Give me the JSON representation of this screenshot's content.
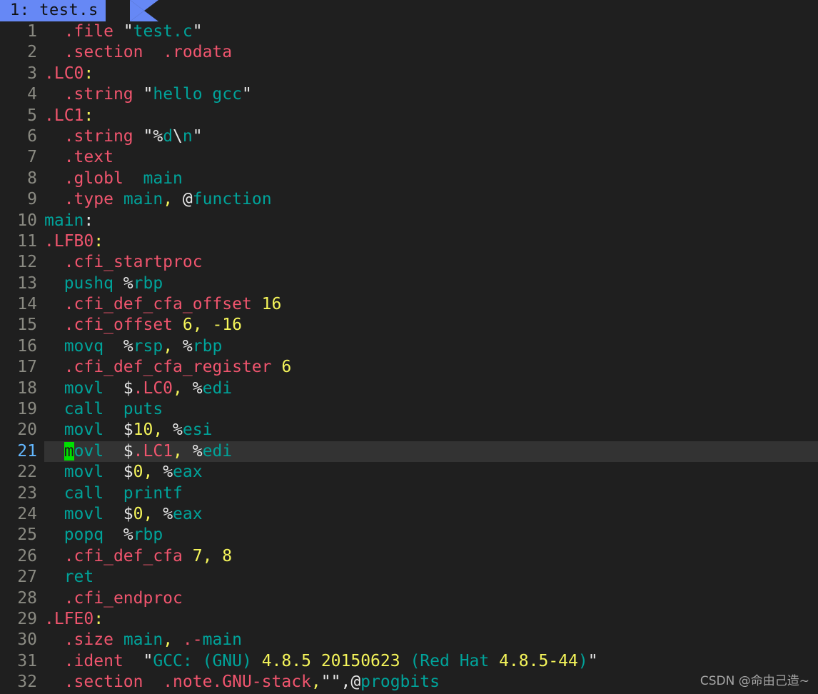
{
  "editor": {
    "tab": {
      "label": "1: test.s",
      "index": "1",
      "filename": "test.s",
      "active_bg": "#6688f5",
      "active_fg": "#101010"
    },
    "background": "#1f1f1f",
    "gutter_color": "#8a8a82",
    "current_line_number": 21,
    "current_line_bg": "#333333",
    "current_line_number_color": "#63b8ff",
    "cursor": {
      "line": 21,
      "column": 3,
      "char": "m",
      "bg": "#00e000",
      "fg": "#1b1b1b"
    },
    "palette": {
      "directive": "#f0556e",
      "identifier": "#00a39a",
      "number": "#f5f55a",
      "plain": "#e6e6e6"
    }
  },
  "watermark": {
    "text": "CSDN @命由己造~"
  },
  "lines": [
    {
      "n": "1",
      "tokens": [
        {
          "t": "plain",
          "v": "  "
        },
        {
          "t": "dir",
          "v": ".file"
        },
        {
          "t": "plain",
          "v": " "
        },
        {
          "t": "plain",
          "v": "\""
        },
        {
          "t": "id",
          "v": "test.c"
        },
        {
          "t": "plain",
          "v": "\""
        }
      ]
    },
    {
      "n": "2",
      "tokens": [
        {
          "t": "plain",
          "v": "  "
        },
        {
          "t": "dir",
          "v": ".section"
        },
        {
          "t": "plain",
          "v": "  "
        },
        {
          "t": "dir",
          "v": ".rodata"
        }
      ]
    },
    {
      "n": "3",
      "tokens": [
        {
          "t": "dir",
          "v": ".LC0"
        },
        {
          "t": "num",
          "v": ":"
        }
      ]
    },
    {
      "n": "4",
      "tokens": [
        {
          "t": "plain",
          "v": "  "
        },
        {
          "t": "dir",
          "v": ".string"
        },
        {
          "t": "plain",
          "v": " \""
        },
        {
          "t": "id",
          "v": "hello gcc"
        },
        {
          "t": "plain",
          "v": "\""
        }
      ]
    },
    {
      "n": "5",
      "tokens": [
        {
          "t": "dir",
          "v": ".LC1"
        },
        {
          "t": "num",
          "v": ":"
        }
      ]
    },
    {
      "n": "6",
      "tokens": [
        {
          "t": "plain",
          "v": "  "
        },
        {
          "t": "dir",
          "v": ".string"
        },
        {
          "t": "plain",
          "v": " \"%"
        },
        {
          "t": "id",
          "v": "d"
        },
        {
          "t": "plain",
          "v": "\\"
        },
        {
          "t": "id",
          "v": "n"
        },
        {
          "t": "plain",
          "v": "\""
        }
      ]
    },
    {
      "n": "7",
      "tokens": [
        {
          "t": "plain",
          "v": "  "
        },
        {
          "t": "dir",
          "v": ".text"
        }
      ]
    },
    {
      "n": "8",
      "tokens": [
        {
          "t": "plain",
          "v": "  "
        },
        {
          "t": "dir",
          "v": ".globl"
        },
        {
          "t": "plain",
          "v": "  "
        },
        {
          "t": "id",
          "v": "main"
        }
      ]
    },
    {
      "n": "9",
      "tokens": [
        {
          "t": "plain",
          "v": "  "
        },
        {
          "t": "dir",
          "v": ".type"
        },
        {
          "t": "plain",
          "v": " "
        },
        {
          "t": "id",
          "v": "main"
        },
        {
          "t": "num",
          "v": ","
        },
        {
          "t": "plain",
          "v": " @"
        },
        {
          "t": "id",
          "v": "function"
        }
      ]
    },
    {
      "n": "10",
      "tokens": [
        {
          "t": "id",
          "v": "main"
        },
        {
          "t": "plain",
          "v": ":"
        }
      ]
    },
    {
      "n": "11",
      "tokens": [
        {
          "t": "dir",
          "v": ".LFB0"
        },
        {
          "t": "num",
          "v": ":"
        }
      ]
    },
    {
      "n": "12",
      "tokens": [
        {
          "t": "plain",
          "v": "  "
        },
        {
          "t": "dir",
          "v": ".cfi_startproc"
        }
      ]
    },
    {
      "n": "13",
      "tokens": [
        {
          "t": "plain",
          "v": "  "
        },
        {
          "t": "id",
          "v": "pushq"
        },
        {
          "t": "plain",
          "v": " %"
        },
        {
          "t": "id",
          "v": "rbp"
        }
      ]
    },
    {
      "n": "14",
      "tokens": [
        {
          "t": "plain",
          "v": "  "
        },
        {
          "t": "dir",
          "v": ".cfi_def_cfa_offset"
        },
        {
          "t": "plain",
          "v": " "
        },
        {
          "t": "num",
          "v": "16"
        }
      ]
    },
    {
      "n": "15",
      "tokens": [
        {
          "t": "plain",
          "v": "  "
        },
        {
          "t": "dir",
          "v": ".cfi_offset"
        },
        {
          "t": "plain",
          "v": " "
        },
        {
          "t": "num",
          "v": "6,"
        },
        {
          "t": "plain",
          "v": " "
        },
        {
          "t": "num",
          "v": "-16"
        }
      ]
    },
    {
      "n": "16",
      "tokens": [
        {
          "t": "plain",
          "v": "  "
        },
        {
          "t": "id",
          "v": "movq"
        },
        {
          "t": "plain",
          "v": "  %"
        },
        {
          "t": "id",
          "v": "rsp"
        },
        {
          "t": "num",
          "v": ","
        },
        {
          "t": "plain",
          "v": " %"
        },
        {
          "t": "id",
          "v": "rbp"
        }
      ]
    },
    {
      "n": "17",
      "tokens": [
        {
          "t": "plain",
          "v": "  "
        },
        {
          "t": "dir",
          "v": ".cfi_def_cfa_register"
        },
        {
          "t": "plain",
          "v": " "
        },
        {
          "t": "num",
          "v": "6"
        }
      ]
    },
    {
      "n": "18",
      "tokens": [
        {
          "t": "plain",
          "v": "  "
        },
        {
          "t": "id",
          "v": "movl"
        },
        {
          "t": "plain",
          "v": "  $"
        },
        {
          "t": "dir",
          "v": ".LC0"
        },
        {
          "t": "num",
          "v": ","
        },
        {
          "t": "plain",
          "v": " %"
        },
        {
          "t": "id",
          "v": "edi"
        }
      ]
    },
    {
      "n": "19",
      "tokens": [
        {
          "t": "plain",
          "v": "  "
        },
        {
          "t": "id",
          "v": "call"
        },
        {
          "t": "plain",
          "v": "  "
        },
        {
          "t": "id",
          "v": "puts"
        }
      ]
    },
    {
      "n": "20",
      "tokens": [
        {
          "t": "plain",
          "v": "  "
        },
        {
          "t": "id",
          "v": "movl"
        },
        {
          "t": "plain",
          "v": "  $"
        },
        {
          "t": "num",
          "v": "10,"
        },
        {
          "t": "plain",
          "v": " %"
        },
        {
          "t": "id",
          "v": "esi"
        }
      ]
    },
    {
      "n": "21",
      "tokens": [
        {
          "t": "plain",
          "v": "  "
        },
        {
          "t": "cursor",
          "v": "m"
        },
        {
          "t": "id",
          "v": "ovl"
        },
        {
          "t": "plain",
          "v": "  $"
        },
        {
          "t": "dir",
          "v": ".LC1"
        },
        {
          "t": "num",
          "v": ","
        },
        {
          "t": "plain",
          "v": " %"
        },
        {
          "t": "id",
          "v": "edi"
        }
      ]
    },
    {
      "n": "22",
      "tokens": [
        {
          "t": "plain",
          "v": "  "
        },
        {
          "t": "id",
          "v": "movl"
        },
        {
          "t": "plain",
          "v": "  $"
        },
        {
          "t": "num",
          "v": "0,"
        },
        {
          "t": "plain",
          "v": " %"
        },
        {
          "t": "id",
          "v": "eax"
        }
      ]
    },
    {
      "n": "23",
      "tokens": [
        {
          "t": "plain",
          "v": "  "
        },
        {
          "t": "id",
          "v": "call"
        },
        {
          "t": "plain",
          "v": "  "
        },
        {
          "t": "id",
          "v": "printf"
        }
      ]
    },
    {
      "n": "24",
      "tokens": [
        {
          "t": "plain",
          "v": "  "
        },
        {
          "t": "id",
          "v": "movl"
        },
        {
          "t": "plain",
          "v": "  $"
        },
        {
          "t": "num",
          "v": "0,"
        },
        {
          "t": "plain",
          "v": " %"
        },
        {
          "t": "id",
          "v": "eax"
        }
      ]
    },
    {
      "n": "25",
      "tokens": [
        {
          "t": "plain",
          "v": "  "
        },
        {
          "t": "id",
          "v": "popq"
        },
        {
          "t": "plain",
          "v": "  %"
        },
        {
          "t": "id",
          "v": "rbp"
        }
      ]
    },
    {
      "n": "26",
      "tokens": [
        {
          "t": "plain",
          "v": "  "
        },
        {
          "t": "dir",
          "v": ".cfi_def_cfa"
        },
        {
          "t": "plain",
          "v": " "
        },
        {
          "t": "num",
          "v": "7,"
        },
        {
          "t": "plain",
          "v": " "
        },
        {
          "t": "num",
          "v": "8"
        }
      ]
    },
    {
      "n": "27",
      "tokens": [
        {
          "t": "plain",
          "v": "  "
        },
        {
          "t": "id",
          "v": "ret"
        }
      ]
    },
    {
      "n": "28",
      "tokens": [
        {
          "t": "plain",
          "v": "  "
        },
        {
          "t": "dir",
          "v": ".cfi_endproc"
        }
      ]
    },
    {
      "n": "29",
      "tokens": [
        {
          "t": "dir",
          "v": ".LFE0"
        },
        {
          "t": "num",
          "v": ":"
        }
      ]
    },
    {
      "n": "30",
      "tokens": [
        {
          "t": "plain",
          "v": "  "
        },
        {
          "t": "dir",
          "v": ".size"
        },
        {
          "t": "plain",
          "v": " "
        },
        {
          "t": "id",
          "v": "main"
        },
        {
          "t": "num",
          "v": ","
        },
        {
          "t": "plain",
          "v": " "
        },
        {
          "t": "dir",
          "v": ".-"
        },
        {
          "t": "id",
          "v": "main"
        }
      ]
    },
    {
      "n": "31",
      "tokens": [
        {
          "t": "plain",
          "v": "  "
        },
        {
          "t": "dir",
          "v": ".ident"
        },
        {
          "t": "plain",
          "v": "  \""
        },
        {
          "t": "id",
          "v": "GCC: "
        },
        {
          "t": "id",
          "v": "(GNU)"
        },
        {
          "t": "plain",
          "v": " "
        },
        {
          "t": "num",
          "v": "4.8.5"
        },
        {
          "t": "plain",
          "v": " "
        },
        {
          "t": "num",
          "v": "20150623"
        },
        {
          "t": "plain",
          "v": " "
        },
        {
          "t": "id",
          "v": "(Red Hat "
        },
        {
          "t": "num",
          "v": "4.8.5-44"
        },
        {
          "t": "id",
          "v": ")"
        },
        {
          "t": "plain",
          "v": "\""
        }
      ]
    },
    {
      "n": "32",
      "tokens": [
        {
          "t": "plain",
          "v": "  "
        },
        {
          "t": "dir",
          "v": ".section"
        },
        {
          "t": "plain",
          "v": "  "
        },
        {
          "t": "dir",
          "v": ".note.GNU-stack"
        },
        {
          "t": "num",
          "v": ","
        },
        {
          "t": "plain",
          "v": "\"\","
        },
        {
          "t": "plain",
          "v": "@"
        },
        {
          "t": "id",
          "v": "progbits"
        }
      ]
    }
  ]
}
